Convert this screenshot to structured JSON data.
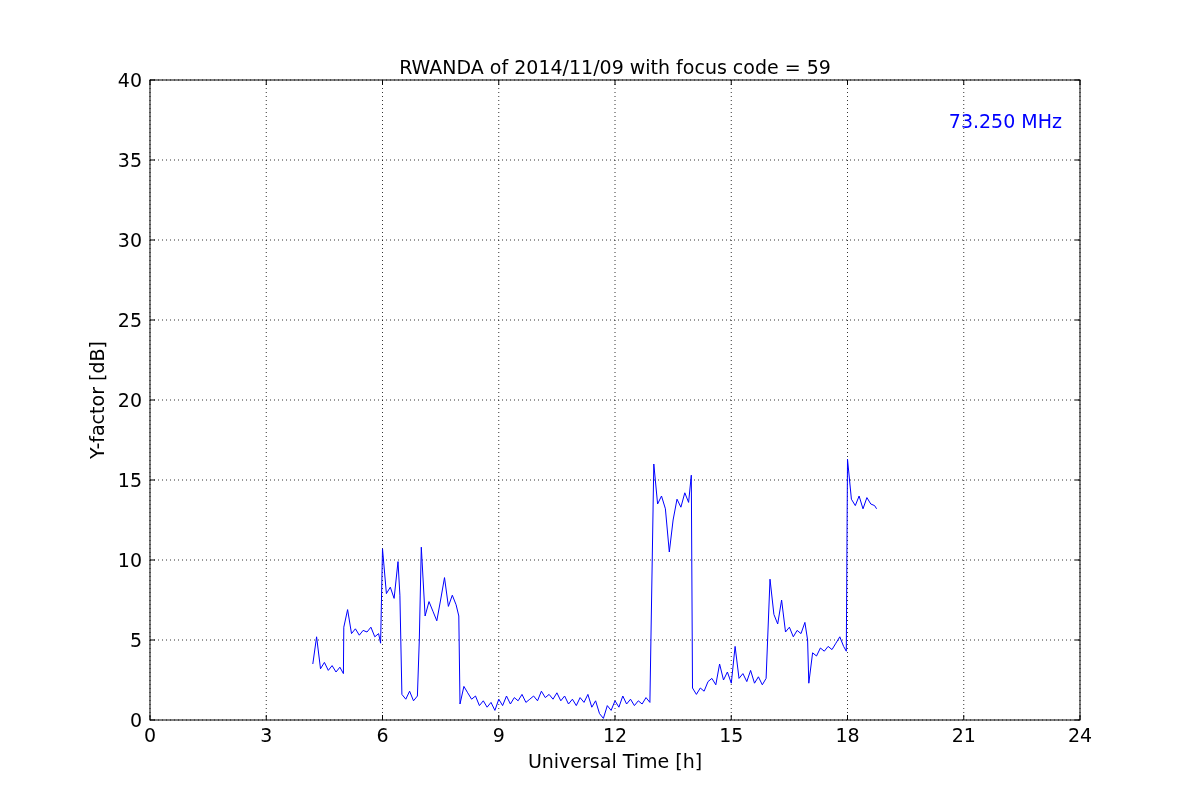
{
  "chart_data": {
    "type": "line",
    "title": "RWANDA of 2014/11/09 with focus code = 59",
    "xlabel": "Universal Time [h]",
    "ylabel": "Y-factor [dB]",
    "xlim": [
      0,
      24
    ],
    "ylim": [
      0,
      40
    ],
    "xticks": [
      0,
      3,
      6,
      9,
      12,
      15,
      18,
      21,
      24
    ],
    "yticks": [
      0,
      5,
      10,
      15,
      20,
      25,
      30,
      35,
      40
    ],
    "x": [
      4.2,
      4.3,
      4.4,
      4.5,
      4.6,
      4.7,
      4.8,
      4.9,
      4.99,
      5.0,
      5.1,
      5.2,
      5.3,
      5.4,
      5.5,
      5.6,
      5.7,
      5.8,
      5.9,
      5.95,
      6.0,
      6.1,
      6.2,
      6.3,
      6.4,
      6.45,
      6.5,
      6.6,
      6.7,
      6.8,
      6.9,
      6.95,
      7.0,
      7.1,
      7.2,
      7.3,
      7.4,
      7.5,
      7.6,
      7.7,
      7.8,
      7.9,
      7.97,
      8.0,
      8.1,
      8.2,
      8.3,
      8.4,
      8.5,
      8.6,
      8.7,
      8.8,
      8.9,
      9.0,
      9.1,
      9.2,
      9.3,
      9.4,
      9.5,
      9.6,
      9.7,
      9.8,
      9.9,
      10.0,
      10.1,
      10.2,
      10.3,
      10.4,
      10.5,
      10.6,
      10.7,
      10.8,
      10.9,
      11.0,
      11.1,
      11.2,
      11.3,
      11.4,
      11.5,
      11.6,
      11.7,
      11.8,
      11.9,
      12.0,
      12.1,
      12.2,
      12.3,
      12.4,
      12.5,
      12.6,
      12.7,
      12.8,
      12.9,
      13.0,
      13.1,
      13.2,
      13.3,
      13.4,
      13.5,
      13.6,
      13.7,
      13.8,
      13.9,
      13.97,
      14.0,
      14.1,
      14.2,
      14.3,
      14.4,
      14.5,
      14.6,
      14.7,
      14.8,
      14.9,
      15.0,
      15.1,
      15.2,
      15.3,
      15.4,
      15.5,
      15.6,
      15.7,
      15.8,
      15.9,
      16.0,
      16.1,
      16.2,
      16.3,
      16.4,
      16.5,
      16.6,
      16.7,
      16.8,
      16.9,
      16.97,
      17.0,
      17.1,
      17.2,
      17.3,
      17.4,
      17.5,
      17.6,
      17.7,
      17.8,
      17.9,
      17.97,
      18.0,
      18.1,
      18.2,
      18.3,
      18.4,
      18.5,
      18.6,
      18.7,
      18.75
    ],
    "series": [
      {
        "color": "#0000ff",
        "values": [
          3.5,
          5.2,
          3.2,
          3.6,
          3.1,
          3.4,
          3.0,
          3.3,
          2.9,
          5.8,
          6.9,
          5.4,
          5.7,
          5.3,
          5.6,
          5.5,
          5.8,
          5.2,
          5.4,
          4.8,
          10.7,
          7.9,
          8.3,
          7.6,
          9.9,
          7.8,
          1.6,
          1.3,
          1.8,
          1.2,
          1.5,
          5.0,
          10.8,
          6.5,
          7.4,
          6.8,
          6.2,
          7.5,
          8.9,
          7.1,
          7.8,
          7.2,
          6.5,
          1.0,
          2.1,
          1.7,
          1.3,
          1.5,
          0.9,
          1.2,
          0.8,
          1.1,
          0.6,
          1.3,
          0.9,
          1.5,
          1.0,
          1.4,
          1.2,
          1.6,
          1.1,
          1.3,
          1.5,
          1.2,
          1.8,
          1.4,
          1.6,
          1.3,
          1.7,
          1.2,
          1.5,
          1.0,
          1.3,
          0.9,
          1.4,
          1.1,
          1.6,
          0.8,
          1.2,
          0.4,
          0.1,
          0.9,
          0.6,
          1.2,
          0.8,
          1.5,
          1.0,
          1.3,
          0.9,
          1.2,
          1.0,
          1.4,
          1.1,
          16.0,
          13.5,
          14.0,
          13.2,
          10.5,
          12.5,
          13.8,
          13.3,
          14.2,
          13.6,
          15.3,
          2.0,
          1.6,
          2.0,
          1.8,
          2.4,
          2.6,
          2.2,
          3.5,
          2.5,
          3.0,
          2.3,
          4.6,
          2.6,
          2.9,
          2.4,
          3.1,
          2.3,
          2.7,
          2.2,
          2.6,
          8.8,
          6.6,
          6.0,
          7.5,
          5.5,
          5.8,
          5.2,
          5.6,
          5.4,
          6.1,
          5.0,
          2.3,
          4.2,
          4.0,
          4.5,
          4.3,
          4.6,
          4.4,
          4.8,
          5.2,
          4.6,
          4.3,
          16.3,
          13.8,
          13.4,
          14.0,
          13.2,
          13.9,
          13.5,
          13.4,
          13.2
        ]
      }
    ],
    "grid": true,
    "annotations": [
      {
        "text": "73.250 MHz"
      }
    ]
  }
}
